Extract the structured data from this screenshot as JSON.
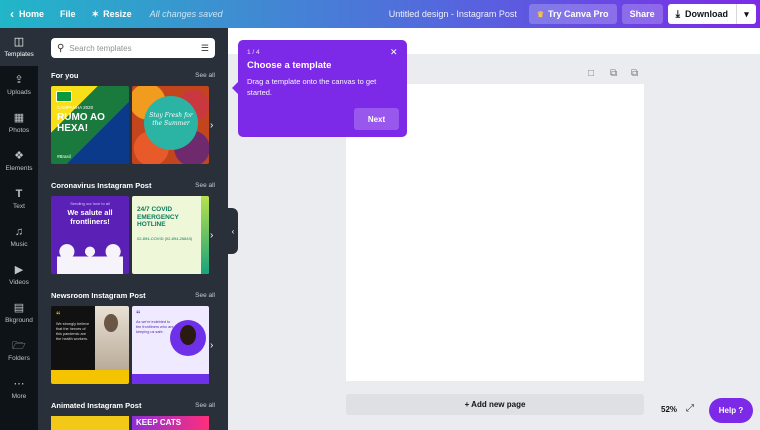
{
  "topbar": {
    "home_label": "Home",
    "file_label": "File",
    "resize_label": "Resize",
    "resize_icon": "sparkle-icon",
    "saved_status": "All changes saved",
    "design_title": "Untitled design - Instagram Post",
    "try_pro_label": "Try Canva Pro",
    "share_label": "Share",
    "download_label": "Download",
    "gradient_start": "#21b6c8",
    "gradient_end": "#7d2ae8"
  },
  "rail": {
    "items": [
      {
        "label": "Templates",
        "icon": "templates-icon",
        "active": true
      },
      {
        "label": "Uploads",
        "icon": "upload-icon"
      },
      {
        "label": "Photos",
        "icon": "photo-icon"
      },
      {
        "label": "Elements",
        "icon": "elements-icon"
      },
      {
        "label": "Text",
        "icon": "text-icon"
      },
      {
        "label": "Music",
        "icon": "music-icon"
      },
      {
        "label": "Videos",
        "icon": "video-icon"
      },
      {
        "label": "Bkground",
        "icon": "background-icon"
      },
      {
        "label": "Folders",
        "icon": "folder-icon"
      },
      {
        "label": "More",
        "icon": "more-icon"
      }
    ]
  },
  "panel": {
    "search_placeholder": "Search templates",
    "sections": [
      {
        "title": "For you",
        "see_all": "See all"
      },
      {
        "title": "Coronavirus Instagram Post",
        "see_all": "See all"
      },
      {
        "title": "Newsroom Instagram Post",
        "see_all": "See all"
      },
      {
        "title": "Animated Instagram Post",
        "see_all": "See all"
      }
    ],
    "templates": {
      "brasil": {
        "small": "CAMPANHA 2020",
        "main": "RUMO AO HEXA!",
        "tag": "#Brasil"
      },
      "fruits": {
        "main": "Stay Fresh for the Summer"
      },
      "covid1": {
        "small": "Sending our love to all",
        "main": "We salute all frontliners!"
      },
      "covid2": {
        "main": "24/7 COVID EMERGENCY HOTLINE",
        "phone": "02-894-COVID (02-894-26843)"
      },
      "news1": {
        "quote": "“",
        "text": "We strongly believe that the heroes of this pandemic are the health workers."
      },
      "news2": {
        "quote": "“",
        "text": "As we're indebted to the frontliners who are keeping us safe."
      },
      "anim2": {
        "main": "KEEP CATS"
      }
    }
  },
  "tooltip": {
    "step": "1 / 4",
    "title": "Choose a template",
    "body": "Drag a template onto the canvas to get started.",
    "next_label": "Next"
  },
  "canvas": {
    "add_page_label": "+ Add new page",
    "zoom_label": "52%",
    "help_label": "Help ?",
    "page_background": "#ffffff"
  }
}
